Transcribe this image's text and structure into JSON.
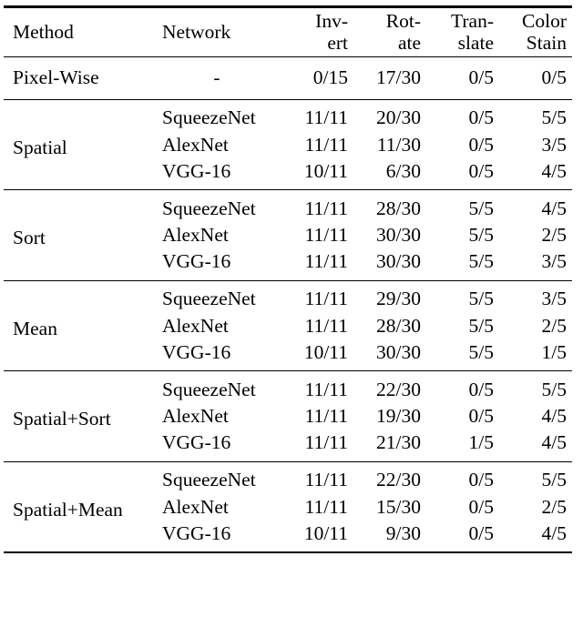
{
  "table": {
    "columns": [
      {
        "key": "method",
        "label": "Method",
        "label_line1": "Method",
        "label_line2": "",
        "align": "left"
      },
      {
        "key": "network",
        "label": "Network",
        "label_line1": "Network",
        "label_line2": "",
        "align": "left"
      },
      {
        "key": "invert",
        "label": "Invert",
        "label_line1": "Inv-",
        "label_line2": "ert",
        "align": "right"
      },
      {
        "key": "rotate",
        "label": "Rotate",
        "label_line1": "Rot-",
        "label_line2": "ate",
        "align": "right"
      },
      {
        "key": "translate",
        "label": "Translate",
        "label_line1": "Tran-",
        "label_line2": "slate",
        "align": "right"
      },
      {
        "key": "colorstain",
        "label": "ColorStain",
        "label_line1": "Color",
        "label_line2": "Stain",
        "align": "right"
      }
    ],
    "groups": [
      {
        "method": "Pixel-Wise",
        "rows": [
          {
            "network": "-",
            "invert": "0/15",
            "rotate": "17/30",
            "translate": "0/5",
            "colorstain": "0/5"
          }
        ]
      },
      {
        "method": "Spatial",
        "rows": [
          {
            "network": "SqueezeNet",
            "invert": "11/11",
            "rotate": "20/30",
            "translate": "0/5",
            "colorstain": "5/5"
          },
          {
            "network": "AlexNet",
            "invert": "11/11",
            "rotate": "11/30",
            "translate": "0/5",
            "colorstain": "3/5"
          },
          {
            "network": "VGG-16",
            "invert": "10/11",
            "rotate": "6/30",
            "translate": "0/5",
            "colorstain": "4/5"
          }
        ]
      },
      {
        "method": "Sort",
        "rows": [
          {
            "network": "SqueezeNet",
            "invert": "11/11",
            "rotate": "28/30",
            "translate": "5/5",
            "colorstain": "4/5"
          },
          {
            "network": "AlexNet",
            "invert": "11/11",
            "rotate": "30/30",
            "translate": "5/5",
            "colorstain": "2/5"
          },
          {
            "network": "VGG-16",
            "invert": "11/11",
            "rotate": "30/30",
            "translate": "5/5",
            "colorstain": "3/5"
          }
        ]
      },
      {
        "method": "Mean",
        "rows": [
          {
            "network": "SqueezeNet",
            "invert": "11/11",
            "rotate": "29/30",
            "translate": "5/5",
            "colorstain": "3/5"
          },
          {
            "network": "AlexNet",
            "invert": "11/11",
            "rotate": "28/30",
            "translate": "5/5",
            "colorstain": "2/5"
          },
          {
            "network": "VGG-16",
            "invert": "10/11",
            "rotate": "30/30",
            "translate": "5/5",
            "colorstain": "1/5"
          }
        ]
      },
      {
        "method": "Spatial+Sort",
        "rows": [
          {
            "network": "SqueezeNet",
            "invert": "11/11",
            "rotate": "22/30",
            "translate": "0/5",
            "colorstain": "5/5"
          },
          {
            "network": "AlexNet",
            "invert": "11/11",
            "rotate": "19/30",
            "translate": "0/5",
            "colorstain": "4/5"
          },
          {
            "network": "VGG-16",
            "invert": "11/11",
            "rotate": "21/30",
            "translate": "1/5",
            "colorstain": "4/5"
          }
        ]
      },
      {
        "method": "Spatial+Mean",
        "rows": [
          {
            "network": "SqueezeNet",
            "invert": "11/11",
            "rotate": "22/30",
            "translate": "0/5",
            "colorstain": "5/5"
          },
          {
            "network": "AlexNet",
            "invert": "11/11",
            "rotate": "15/30",
            "translate": "0/5",
            "colorstain": "2/5"
          },
          {
            "network": "VGG-16",
            "invert": "10/11",
            "rotate": "9/30",
            "translate": "0/5",
            "colorstain": "4/5"
          }
        ]
      }
    ]
  }
}
